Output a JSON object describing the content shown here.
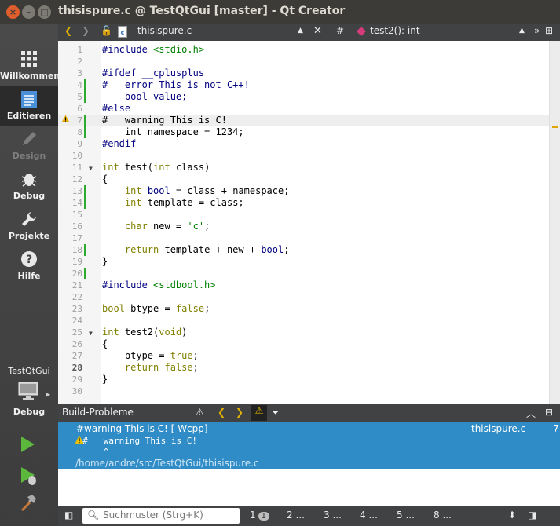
{
  "window": {
    "title": "thisispure.c @ TestQtGui [master] - Qt Creator",
    "close_glyph": "×",
    "minimize_glyph": "–",
    "maximize_glyph": "□"
  },
  "sidebar": {
    "modes": [
      {
        "label": "Willkommen",
        "icon": "grid-icon"
      },
      {
        "label": "Editieren",
        "icon": "document-icon"
      },
      {
        "label": "Design",
        "icon": "pen-icon"
      },
      {
        "label": "Debug",
        "icon": "bug-icon"
      },
      {
        "label": "Projekte",
        "icon": "wrench-icon"
      },
      {
        "label": "Hilfe",
        "icon": "help-icon"
      }
    ],
    "kit": {
      "project": "TestQtGui",
      "config": "Debug"
    }
  },
  "editor_toolbar": {
    "file": "thisispure.c",
    "hash": "#",
    "symbol": "test2(): int"
  },
  "colors": {
    "accent": "#308cc6",
    "changed_bar": "#2eaa2e",
    "warning": "#e0a800"
  },
  "code_lines": [
    "1",
    "2",
    "3",
    "4",
    "5",
    "6",
    "7",
    "8",
    "9",
    "10",
    "11",
    "12",
    "13",
    "14",
    "15",
    "16",
    "17",
    "18",
    "19",
    "20",
    "21",
    "22",
    "23",
    "24",
    "25",
    "26",
    "27",
    "28",
    "29",
    "30"
  ],
  "output": {
    "title": "Build-Probleme",
    "issue_title": "#warning This is C! [-Wcpp]",
    "issue_file": "thisispure.c",
    "issue_line": "7",
    "issue_code": "  #   warning This is C!",
    "issue_caret": "      ^",
    "issue_path": "/home/andre/src/TestQtGui/thisispure.c"
  },
  "statusbar": {
    "search_placeholder": "Suchmuster (Strg+K)",
    "tabs": [
      {
        "num": "1",
        "badge": "1"
      },
      {
        "num": "2",
        "dots": "..."
      },
      {
        "num": "3",
        "dots": "..."
      },
      {
        "num": "4",
        "dots": "..."
      },
      {
        "num": "5",
        "dots": "..."
      },
      {
        "num": "8",
        "dots": "..."
      }
    ]
  }
}
